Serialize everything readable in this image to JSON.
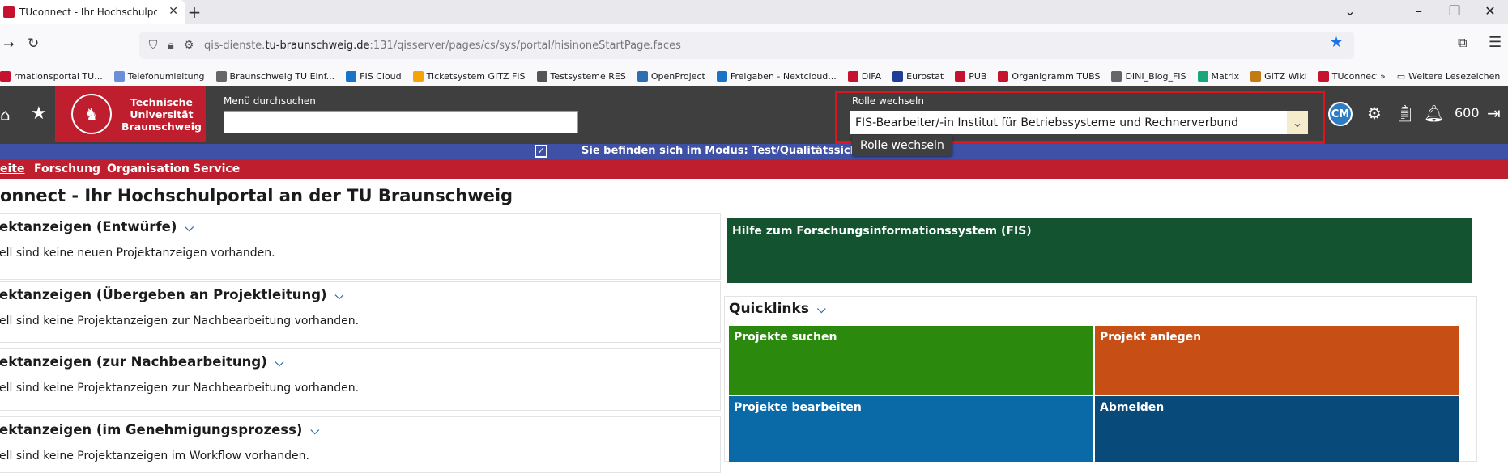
{
  "browser": {
    "tab_title": "TUconnect - Ihr Hochschulportal",
    "url_prefix": "qis-dienste.",
    "url_domain": "tu-braunschweig.de",
    "url_suffix": ":131/qisserver/pages/cs/sys/portal/hisinoneStartPage.faces",
    "bookmarks": [
      {
        "label": "rmationsportal TU...",
        "color": "#c4122f"
      },
      {
        "label": "Telefonumleitung",
        "color": "#6a8fd8"
      },
      {
        "label": "Braunschweig TU Einf...",
        "color": "#666666"
      },
      {
        "label": "FIS Cloud",
        "color": "#1a73c8"
      },
      {
        "label": "Ticketsystem GITZ FIS",
        "color": "#f4a30b"
      },
      {
        "label": "Testsysteme RES",
        "color": "#555555"
      },
      {
        "label": "OpenProject",
        "color": "#2d6db6"
      },
      {
        "label": "Freigaben - Nextcloud...",
        "color": "#1a73c8"
      },
      {
        "label": "DiFA",
        "color": "#c4122f"
      },
      {
        "label": "Eurostat",
        "color": "#1f3e99"
      },
      {
        "label": "PUB",
        "color": "#c4122f"
      },
      {
        "label": "Organigramm TUBS",
        "color": "#c4122f"
      },
      {
        "label": "DINI_Blog_FIS",
        "color": "#666666"
      },
      {
        "label": "Matrix",
        "color": "#1aa775"
      },
      {
        "label": "GITZ Wiki",
        "color": "#c47a12"
      },
      {
        "label": "TUconnect",
        "color": "#c4122f"
      }
    ],
    "bookmarks_more": "Weitere Lesezeichen"
  },
  "header": {
    "logo_line1": "Technische",
    "logo_line2": "Universität",
    "logo_line3": "Braunschweig",
    "menu_search_label": "Menü durchsuchen",
    "role_label": "Rolle wechseln",
    "role_value": "FIS-Bearbeiter/-in Institut für Betriebssysteme und Rechnerverbund",
    "avatar_initials": "CM",
    "counter": "600",
    "tooltip": "Rolle wechseln"
  },
  "mode_bar": {
    "text": "Sie befinden sich im Modus: Test/Qualitätssicherung"
  },
  "nav": {
    "items": [
      "eite",
      "Forschung",
      "Organisation",
      "Service"
    ]
  },
  "page": {
    "title": "onnect - Ihr Hochschulportal an der TU Braunschweig",
    "panels": [
      {
        "title": "ektanzeigen (Entwürfe)",
        "text": "ell sind keine neuen Projektanzeigen vorhanden."
      },
      {
        "title": "ektanzeigen (Übergeben an Projektleitung)",
        "text": "ell sind keine Projektanzeigen zur Nachbearbeitung vorhanden."
      },
      {
        "title": "ektanzeigen (zur Nachbearbeitung)",
        "text": "ell sind keine Projektanzeigen zur Nachbearbeitung vorhanden."
      },
      {
        "title": "ektanzeigen (im Genehmigungsprozess)",
        "text": "ell sind keine Projektanzeigen im Workflow vorhanden."
      }
    ],
    "help_tile": "Hilfe zum Forschungsinformationssystem (FIS)",
    "quicklinks_title": "Quicklinks",
    "tiles": [
      {
        "label": "Projekte suchen",
        "color": "#2b8a0e"
      },
      {
        "label": "Projekt anlegen",
        "color": "#c74e14"
      },
      {
        "label": "Projekte bearbeiten",
        "color": "#0a6aa8"
      },
      {
        "label": "Abmelden",
        "color": "#084b7a"
      }
    ]
  }
}
